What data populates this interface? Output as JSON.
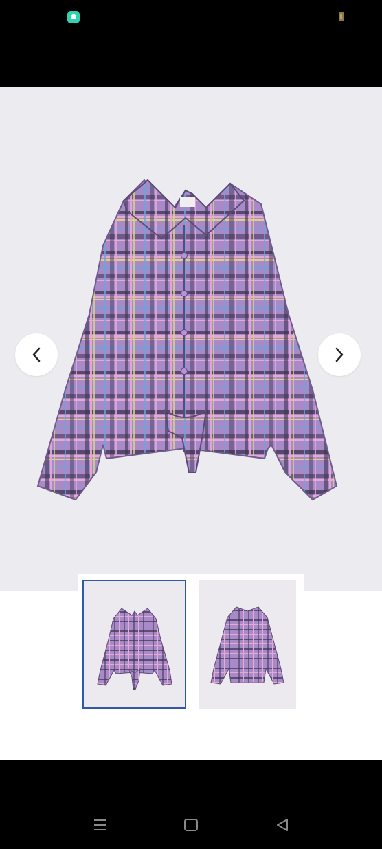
{
  "status_bar": {
    "left_icon": "chat-app-icon",
    "right_icon": "battery-icon"
  },
  "product_gallery": {
    "main_image": "purple-plaid-tie-front-shirt",
    "prev_icon": "chevron-left-icon",
    "next_icon": "chevron-right-icon",
    "thumbnails": [
      {
        "view": "front",
        "selected": true
      },
      {
        "view": "back",
        "selected": false
      }
    ],
    "colors": {
      "shirt_base": "#a98ac9",
      "plaid_dark": "#3c3350",
      "plaid_pink": "#e6a9d6",
      "plaid_yellow": "#d9d37a",
      "plaid_blue": "#6fa2d8",
      "selected_border": "#2f5aa8"
    }
  },
  "system_nav": {
    "menu_icon": "recent-apps-icon",
    "home_icon": "home-icon",
    "back_icon": "back-triangle-icon"
  }
}
